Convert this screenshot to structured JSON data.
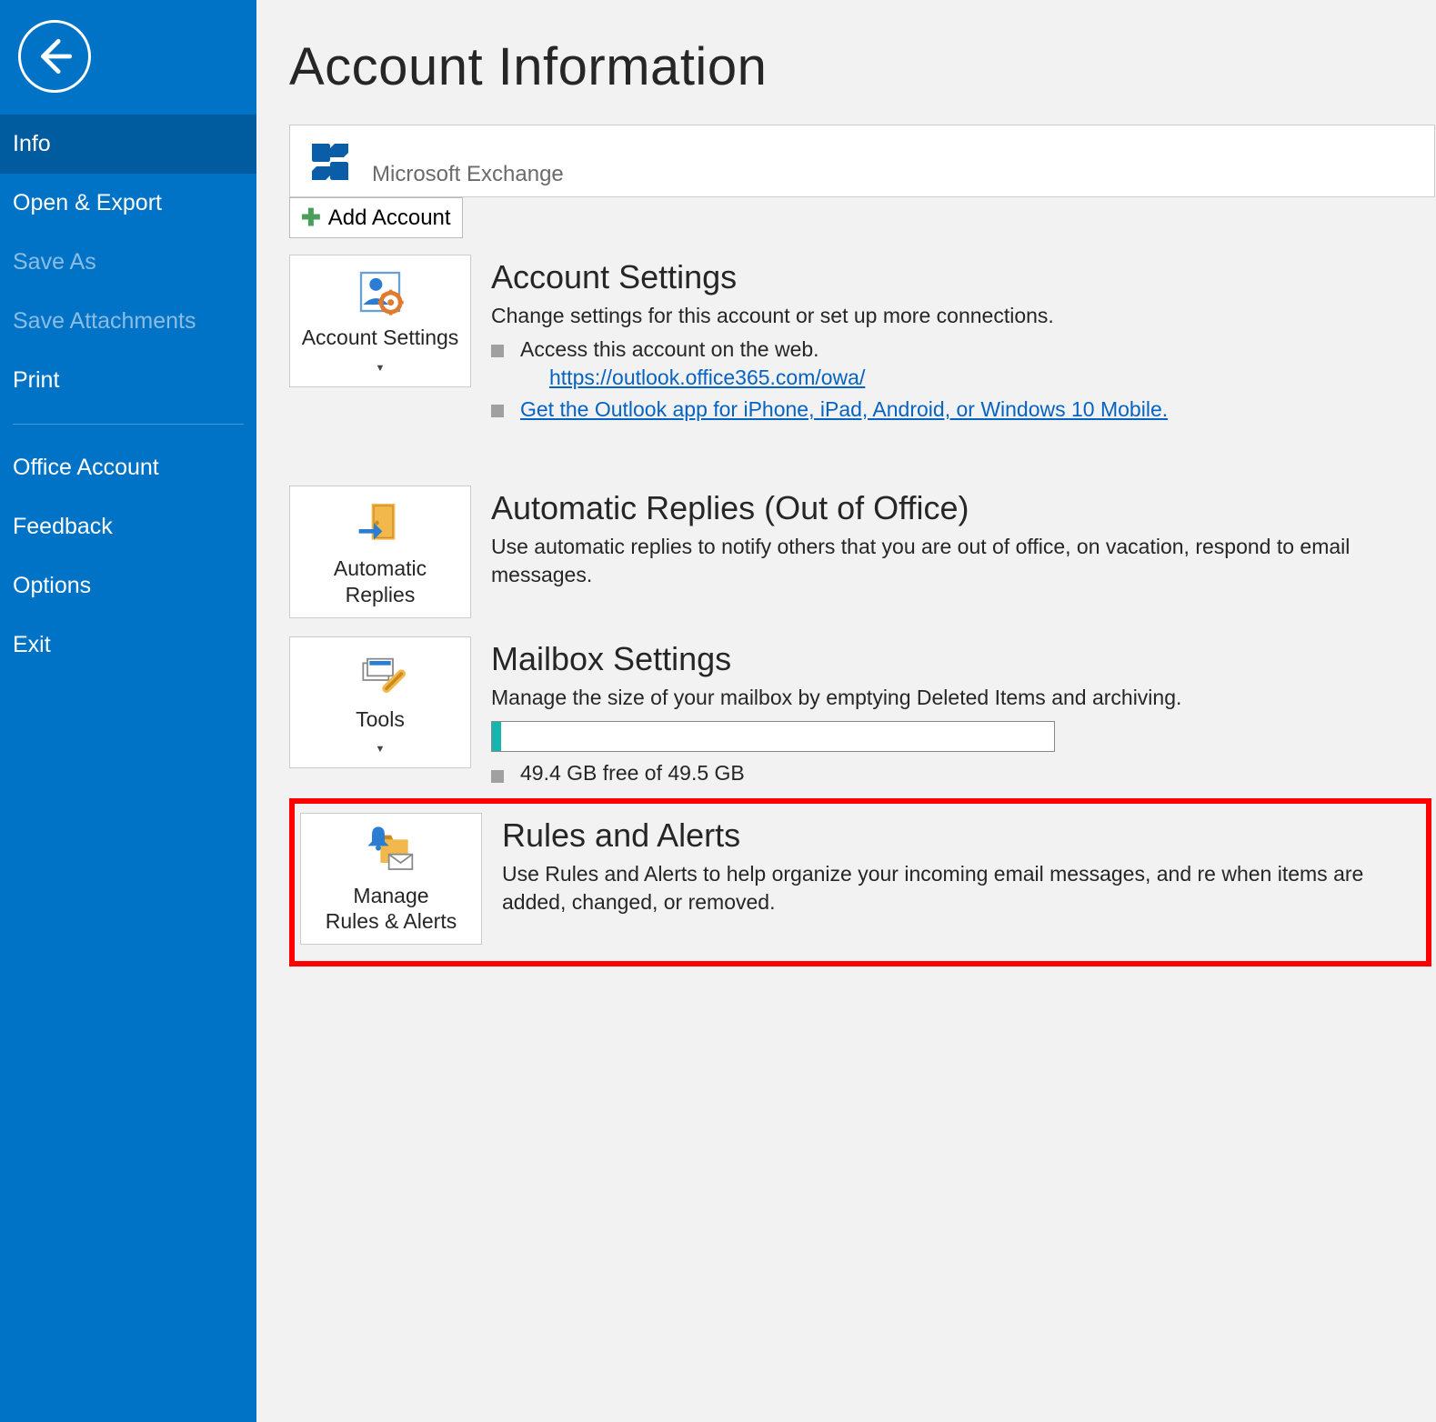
{
  "sidebar": {
    "items": [
      {
        "label": "Info",
        "state": "selected"
      },
      {
        "label": "Open & Export",
        "state": "normal"
      },
      {
        "label": "Save As",
        "state": "disabled"
      },
      {
        "label": "Save Attachments",
        "state": "disabled"
      },
      {
        "label": "Print",
        "state": "normal"
      },
      {
        "label": "Office Account",
        "state": "normal"
      },
      {
        "label": "Feedback",
        "state": "normal"
      },
      {
        "label": "Options",
        "state": "normal"
      },
      {
        "label": "Exit",
        "state": "normal"
      }
    ]
  },
  "page": {
    "title": "Account Information",
    "account_type": "Microsoft Exchange",
    "add_account_label": "Add Account"
  },
  "sections": {
    "account_settings": {
      "tile_label": "Account Settings",
      "heading": "Account Settings",
      "desc": "Change settings for this account or set up more connections.",
      "bullets": {
        "access_web": "Access this account on the web.",
        "owa_url": "https://outlook.office365.com/owa/",
        "get_app": "Get the Outlook app for iPhone, iPad, Android, or Windows 10 Mobile."
      }
    },
    "auto_replies": {
      "tile_label_line1": "Automatic",
      "tile_label_line2": "Replies",
      "heading": "Automatic Replies (Out of Office)",
      "desc": "Use automatic replies to notify others that you are out of office, on vacation, respond to email messages."
    },
    "mailbox": {
      "tile_label": "Tools",
      "heading": "Mailbox Settings",
      "desc": "Manage the size of your mailbox by emptying Deleted Items and archiving.",
      "storage_text": "49.4 GB free of 49.5 GB"
    },
    "rules": {
      "tile_label_line1": "Manage",
      "tile_label_line2": "Rules & Alerts",
      "heading": "Rules and Alerts",
      "desc": "Use Rules and Alerts to help organize your incoming email messages, and re when items are added, changed, or removed."
    }
  }
}
